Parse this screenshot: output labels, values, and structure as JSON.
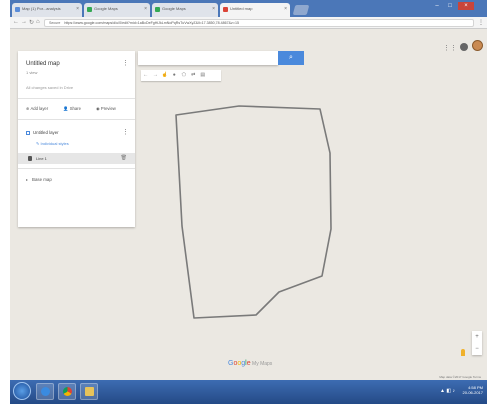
{
  "browser": {
    "tabs": [
      {
        "label": "Map (1) Por...analysis",
        "active": false,
        "color": "#5a8cd8"
      },
      {
        "label": "Google Maps",
        "active": false,
        "color": "#34a853"
      },
      {
        "label": "Google Maps",
        "active": false,
        "color": "#34a853"
      },
      {
        "label": "Untitled map",
        "active": true,
        "color": "#db4437"
      }
    ],
    "url_secure": "Secure",
    "url": "https://www.google.com/maps/d/u/0/edit?mid=1aBcDeFgHiJkLmNoPqRsTuVwXyZ&ll=17.3850,78.4867&z=15"
  },
  "map_panel": {
    "title": "Untitled map",
    "views": "1 view",
    "saved_status": "All changes saved in Drive",
    "actions": [
      "Add layer",
      "Share",
      "Preview"
    ],
    "layer": "Untitled layer",
    "add_directions": "Individual styles",
    "feature": "Line 1",
    "base_map": "Base map"
  },
  "search": {
    "placeholder": ""
  },
  "tools": [
    "←",
    "→",
    "☝",
    "●",
    "⬠",
    "⇄",
    "▤"
  ],
  "zoom": {
    "in": "+",
    "out": "−"
  },
  "logo": {
    "g": "Google",
    "rest": " My Maps"
  },
  "footer": "Map data ©2017 Google  Terms",
  "tray": {
    "time": "4:58 PM",
    "date": "20-06-2017"
  },
  "icons": {
    "apps": "apps-icon",
    "notifications": "bell-icon",
    "start": "windows-start-icon"
  }
}
